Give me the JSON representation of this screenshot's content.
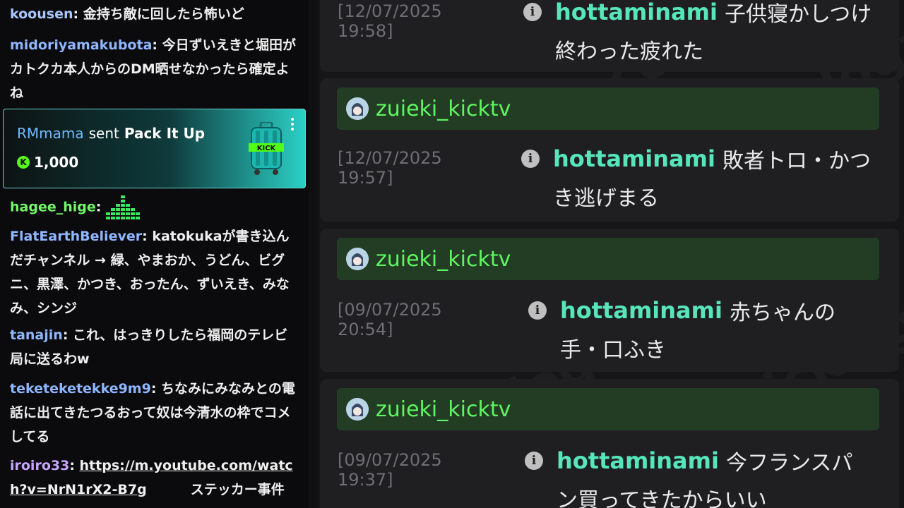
{
  "chat": {
    "messages": [
      {
        "user": "koousen",
        "user_color": "#a9c7ff",
        "text": "金持ち敵に回したら怖いど"
      },
      {
        "user": "midoriyamakubota",
        "user_color": "#8fb6ff",
        "text": "今日ずいえきと堀田がカトクカ本人からのDM晒せなかったら確定よね"
      },
      {
        "user": "hagee_hige",
        "user_color": "#74f56a",
        "text": "",
        "emote": "green-equalizer-emote"
      },
      {
        "user": "FlatEarthBeliever",
        "user_color": "#8fb6ff",
        "text": "katokukaが書き込んだチャンネル → 緑、やまおか、うどん、ビグニ、黒澤、かつき、おったん、ずいえき、みなみ、シンジ"
      },
      {
        "user": "tanajin",
        "user_color": "#8fb6ff",
        "text": "これ、はっきりしたら福岡のテレビ局に送るわw"
      },
      {
        "user": "teketeketekke9m9",
        "user_color": "#8fb6ff",
        "text": "ちなみにみなみとの電話に出てきたつるおって奴は今清水の枠でコメしてる"
      },
      {
        "user": "iroiro33",
        "user_color": "#c7a6ff",
        "link": "https://m.youtube.com/watch?v=NrN1rX2-B7g",
        "text": "ステッカー事件"
      }
    ],
    "gift": {
      "gifter": "RMmama",
      "sent": "sent",
      "item": "Pack It Up",
      "amount": "1,000",
      "coin_icon": "kick-coin-icon"
    }
  },
  "log": {
    "cards": [
      {
        "channel": "",
        "timestamp": "[12/07/2025 19:58]",
        "user": "hottaminami",
        "message_line1": "子供寝かしつけ",
        "message_line2": "終わった疲れた"
      },
      {
        "channel": "zuieki_kicktv",
        "timestamp": "[12/07/2025 19:57]",
        "user": "hottaminami",
        "message_line1": "敗者トロ・かつ",
        "message_line2": "き逃げまる"
      },
      {
        "channel": "zuieki_kicktv",
        "timestamp": "[09/07/2025 20:54]",
        "user": "hottaminami",
        "message_line1": "赤ちゃんの",
        "message_line2": "手・口ふき"
      },
      {
        "channel": "zuieki_kicktv",
        "timestamp": "[09/07/2025 19:37]",
        "user": "hottaminami",
        "message_line1": "今フランスパ",
        "message_line2": "ン買ってきたからいい"
      }
    ],
    "watermark": "kicklogz.com",
    "colors": {
      "channel_name": "#5ff562",
      "username": "#56e6b8",
      "channel_bar": "#233d24",
      "card": "#1f1f22"
    }
  }
}
